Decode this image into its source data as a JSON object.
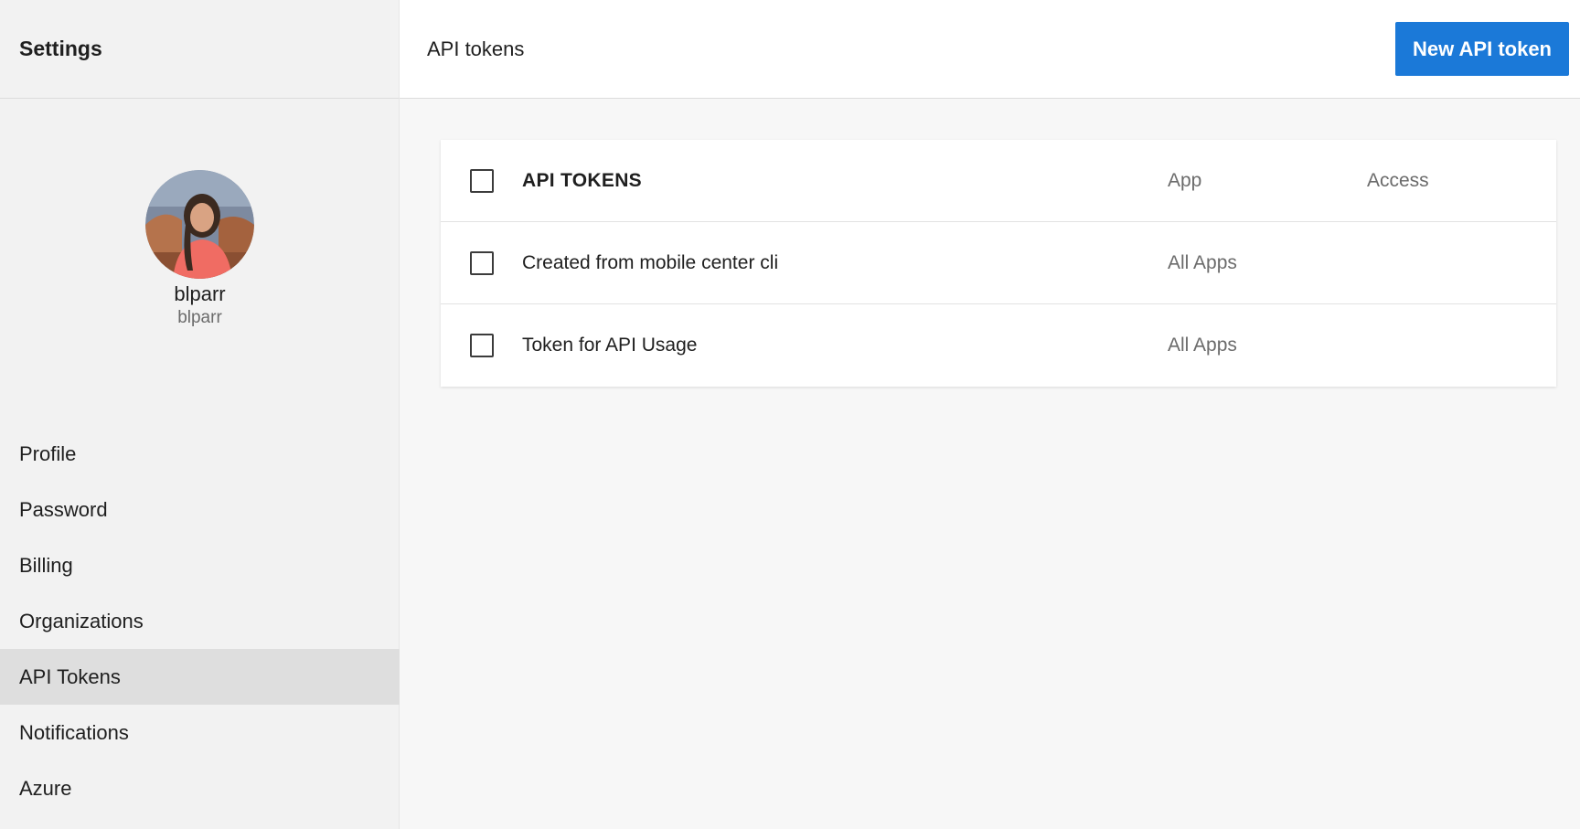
{
  "sidebar": {
    "title": "Settings",
    "user": {
      "display_name": "blparr",
      "username": "blparr"
    },
    "items": [
      {
        "label": "Profile"
      },
      {
        "label": "Password"
      },
      {
        "label": "Billing"
      },
      {
        "label": "Organizations"
      },
      {
        "label": "API Tokens",
        "active": true
      },
      {
        "label": "Notifications"
      },
      {
        "label": "Azure"
      }
    ]
  },
  "header": {
    "title": "API tokens",
    "new_button_label": "New API token"
  },
  "table": {
    "columns": {
      "name": "API TOKENS",
      "app": "App",
      "access": "Access"
    },
    "rows": [
      {
        "name": "Created from mobile center cli",
        "app": "All Apps",
        "access": ""
      },
      {
        "name": "Token for API Usage",
        "app": "All Apps",
        "access": ""
      }
    ]
  },
  "colors": {
    "accent": "#1b79d8",
    "sidebar_bg": "#f2f2f2",
    "active_item_bg": "#dedede"
  }
}
